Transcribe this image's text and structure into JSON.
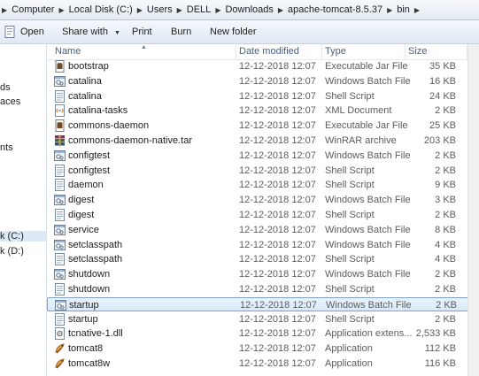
{
  "breadcrumb": [
    "Computer",
    "Local Disk (C:)",
    "Users",
    "DELL",
    "Downloads",
    "apache-tomcat-8.5.37",
    "bin"
  ],
  "toolbar": {
    "open": "Open",
    "share_with": "Share with",
    "print": "Print",
    "burn": "Burn",
    "new_folder": "New folder"
  },
  "nav": {
    "items": [
      {
        "label": "ds"
      },
      {
        "label": "aces"
      },
      {
        "label": "nts"
      },
      {
        "label": "k (C:)"
      },
      {
        "label": "k (D:)"
      }
    ]
  },
  "columns": {
    "name": "Name",
    "date": "Date modified",
    "type": "Type",
    "size": "Size"
  },
  "files": [
    {
      "name": "bootstrap",
      "date": "12-12-2018 12:07",
      "type": "Executable Jar File",
      "size": "35 KB",
      "icon": "jar-file-icon"
    },
    {
      "name": "catalina",
      "date": "12-12-2018 12:07",
      "type": "Windows Batch File",
      "size": "16 KB",
      "icon": "batch-file-icon"
    },
    {
      "name": "catalina",
      "date": "12-12-2018 12:07",
      "type": "Shell Script",
      "size": "24 KB",
      "icon": "script-file-icon"
    },
    {
      "name": "catalina-tasks",
      "date": "12-12-2018 12:07",
      "type": "XML Document",
      "size": "2 KB",
      "icon": "xml-file-icon"
    },
    {
      "name": "commons-daemon",
      "date": "12-12-2018 12:07",
      "type": "Executable Jar File",
      "size": "25 KB",
      "icon": "jar-file-icon"
    },
    {
      "name": "commons-daemon-native.tar",
      "date": "12-12-2018 12:07",
      "type": "WinRAR archive",
      "size": "203 KB",
      "icon": "winrar-archive-icon"
    },
    {
      "name": "configtest",
      "date": "12-12-2018 12:07",
      "type": "Windows Batch File",
      "size": "2 KB",
      "icon": "batch-file-icon"
    },
    {
      "name": "configtest",
      "date": "12-12-2018 12:07",
      "type": "Shell Script",
      "size": "2 KB",
      "icon": "script-file-icon"
    },
    {
      "name": "daemon",
      "date": "12-12-2018 12:07",
      "type": "Shell Script",
      "size": "9 KB",
      "icon": "script-file-icon"
    },
    {
      "name": "digest",
      "date": "12-12-2018 12:07",
      "type": "Windows Batch File",
      "size": "3 KB",
      "icon": "batch-file-icon"
    },
    {
      "name": "digest",
      "date": "12-12-2018 12:07",
      "type": "Shell Script",
      "size": "2 KB",
      "icon": "script-file-icon"
    },
    {
      "name": "service",
      "date": "12-12-2018 12:07",
      "type": "Windows Batch File",
      "size": "8 KB",
      "icon": "batch-file-icon"
    },
    {
      "name": "setclasspath",
      "date": "12-12-2018 12:07",
      "type": "Windows Batch File",
      "size": "4 KB",
      "icon": "batch-file-icon"
    },
    {
      "name": "setclasspath",
      "date": "12-12-2018 12:07",
      "type": "Shell Script",
      "size": "4 KB",
      "icon": "script-file-icon"
    },
    {
      "name": "shutdown",
      "date": "12-12-2018 12:07",
      "type": "Windows Batch File",
      "size": "2 KB",
      "icon": "batch-file-icon"
    },
    {
      "name": "shutdown",
      "date": "12-12-2018 12:07",
      "type": "Shell Script",
      "size": "2 KB",
      "icon": "script-file-icon"
    },
    {
      "name": "startup",
      "date": "12-12-2018 12:07",
      "type": "Windows Batch File",
      "size": "2 KB",
      "icon": "batch-file-icon",
      "selected": true
    },
    {
      "name": "startup",
      "date": "12-12-2018 12:07",
      "type": "Shell Script",
      "size": "2 KB",
      "icon": "script-file-icon"
    },
    {
      "name": "tcnative-1.dll",
      "date": "12-12-2018 12:07",
      "type": "Application extens...",
      "size": "2,533 KB",
      "icon": "dll-file-icon"
    },
    {
      "name": "tomcat8",
      "date": "12-12-2018 12:07",
      "type": "Application",
      "size": "112 KB",
      "icon": "tomcat-app-icon"
    },
    {
      "name": "tomcat8w",
      "date": "12-12-2018 12:07",
      "type": "Application",
      "size": "116 KB",
      "icon": "tomcat-app-icon"
    }
  ]
}
